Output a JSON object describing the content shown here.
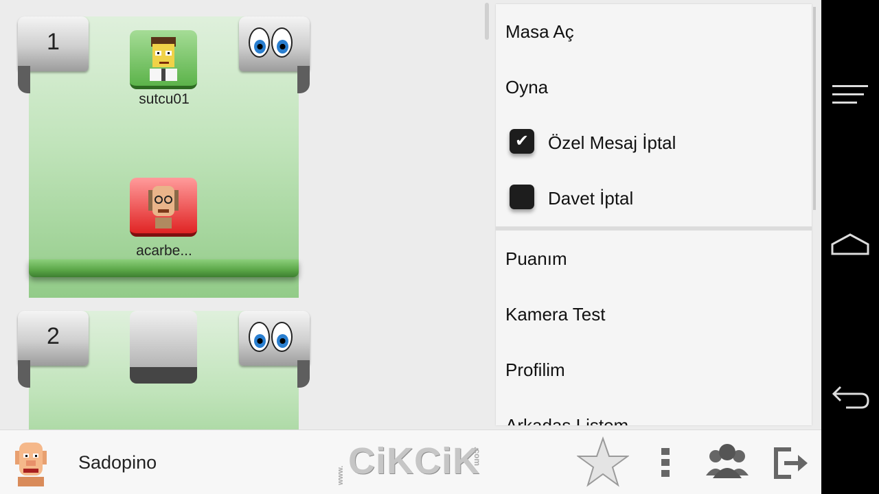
{
  "tables": [
    {
      "number": "1",
      "players": [
        {
          "name": "sutcu01",
          "seat_color": "green"
        },
        {
          "name": "acarbe...",
          "seat_color": "red"
        }
      ]
    },
    {
      "number": "2",
      "players": []
    }
  ],
  "menu": {
    "items": [
      {
        "label": "Masa Aç"
      },
      {
        "label": "Oyna"
      }
    ],
    "checks": [
      {
        "label": "Özel Mesaj İptal",
        "checked": true
      },
      {
        "label": "Davet İptal",
        "checked": false
      }
    ],
    "items_after": [
      {
        "label": "Puanım"
      },
      {
        "label": "Kamera Test"
      },
      {
        "label": "Profilim"
      },
      {
        "label": "Arkadaş Listem"
      }
    ]
  },
  "bottom_bar": {
    "username": "Sadopino",
    "logo": {
      "prefix": "www.",
      "text": "CiKCiK",
      "suffix": ".com"
    },
    "icons": [
      "star-icon",
      "more-icon",
      "friends-icon",
      "exit-icon"
    ]
  },
  "system_nav": [
    "menu-icon",
    "home-icon",
    "back-icon"
  ],
  "colors": {
    "green_seat": "#5cb34a",
    "red_seat": "#e02424",
    "table_green": "#c1e4bb",
    "nav_bg": "#000000"
  }
}
